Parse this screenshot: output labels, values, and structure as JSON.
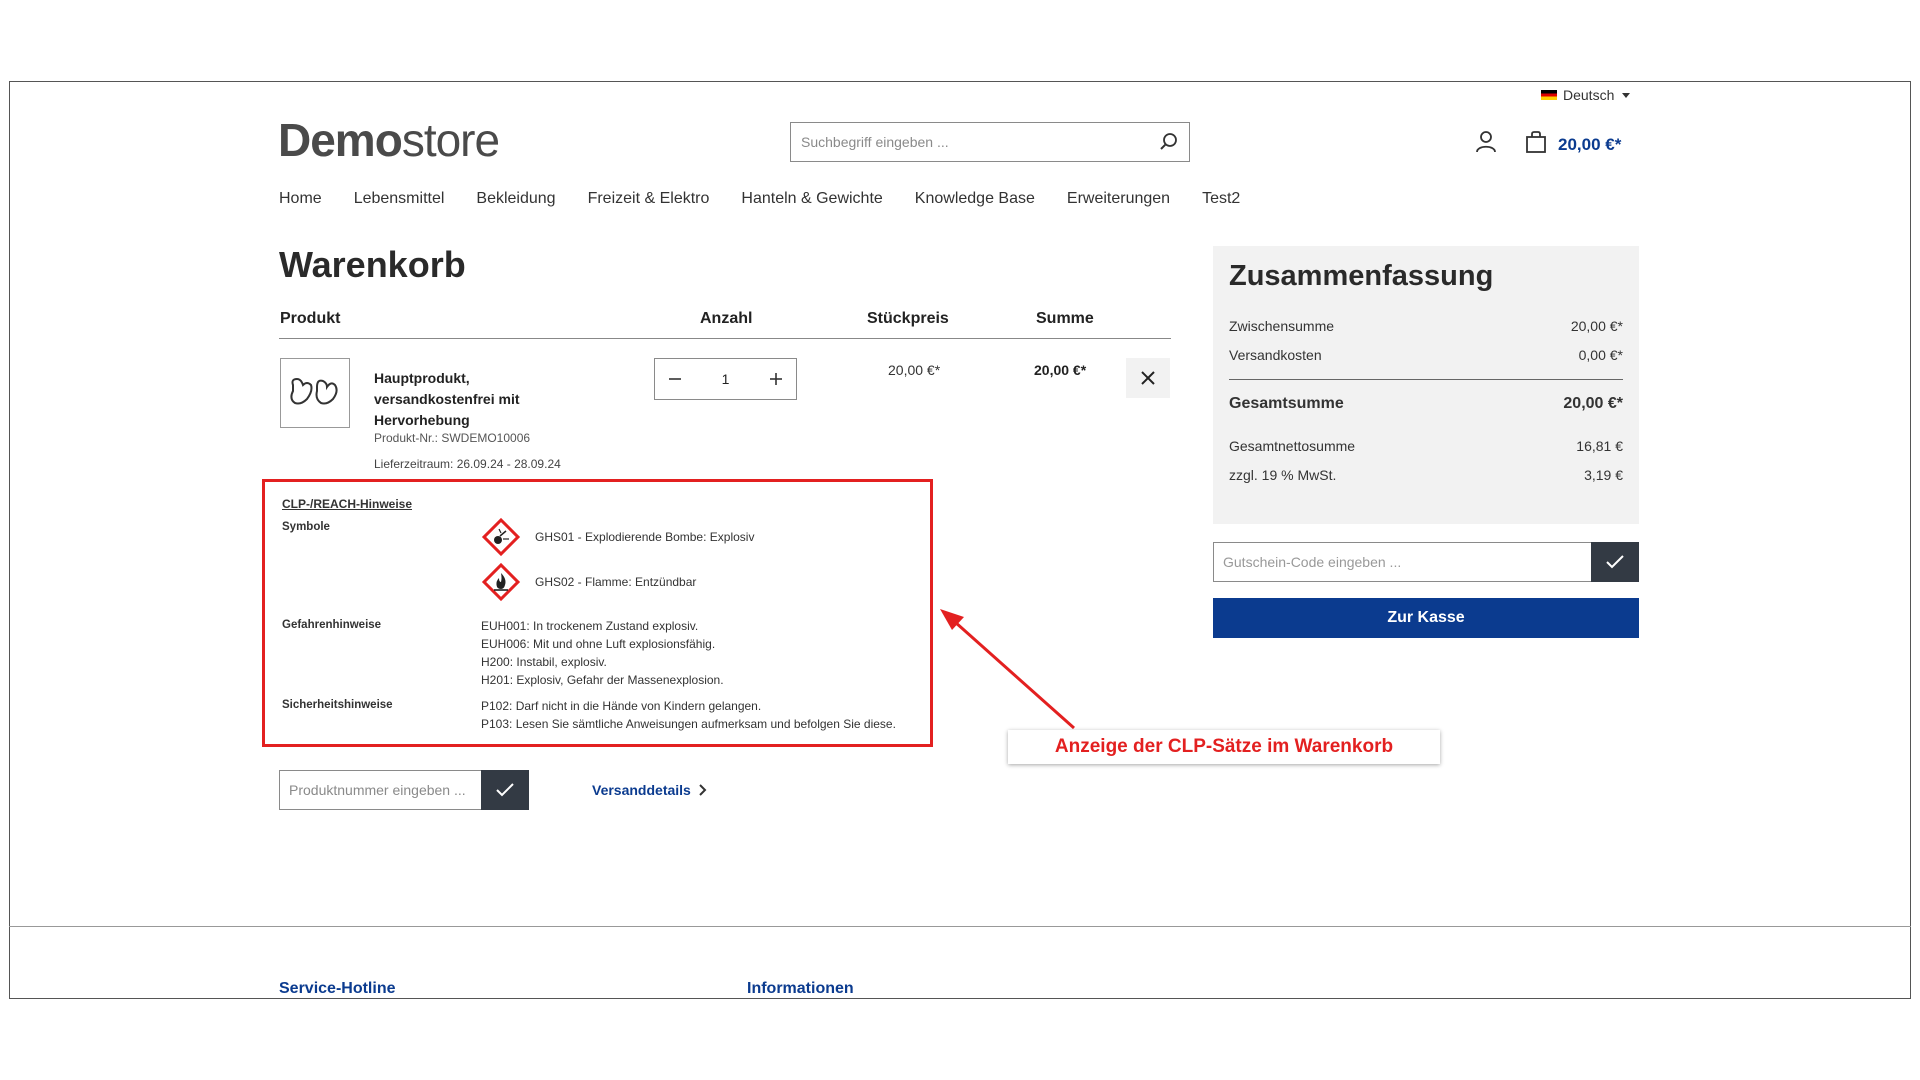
{
  "header": {
    "language": "Deutsch",
    "logo_bold": "Demo",
    "logo_light": "store",
    "search_placeholder": "Suchbegriff eingeben ...",
    "cart_total": "20,00 €*"
  },
  "nav": [
    "Home",
    "Lebensmittel",
    "Bekleidung",
    "Freizeit & Elektro",
    "Hanteln & Gewichte",
    "Knowledge Base",
    "Erweiterungen",
    "Test2"
  ],
  "cart": {
    "title": "Warenkorb",
    "columns": {
      "product": "Produkt",
      "quantity": "Anzahl",
      "unit_price": "Stückpreis",
      "total": "Summe"
    },
    "item": {
      "name": "Hauptprodukt, versandkostenfrei mit Hervorhebung",
      "number": "Produkt-Nr.: SWDEMO10006",
      "delivery": "Lieferzeitraum: 26.09.24 - 28.09.24",
      "quantity": "1",
      "unit_price": "20,00 €*",
      "total": "20,00 €*"
    },
    "clp": {
      "title": "CLP-/REACH-Hinweise",
      "symbols_label": "Symbole",
      "symbols": [
        {
          "icon": "ghs01-exploding-bomb-icon",
          "text": "GHS01 - Explodierende Bombe: Explosiv"
        },
        {
          "icon": "ghs02-flame-icon",
          "text": "GHS02 - Flamme: Entzündbar"
        }
      ],
      "hazard_label": "Gefahrenhinweise",
      "hazards": [
        "EUH001: In trockenem Zustand explosiv.",
        "EUH006: Mit und ohne Luft explosionsfähig.",
        "H200: Instabil, explosiv.",
        "H201: Explosiv, Gefahr der Massenexplosion."
      ],
      "safety_label": "Sicherheitshinweise",
      "safety": [
        "P102: Darf nicht in die Hände von Kindern gelangen.",
        "P103: Lesen Sie sämtliche Anweisungen aufmerksam und befolgen Sie diese."
      ]
    },
    "product_number_placeholder": "Produktnummer eingeben ...",
    "shipping_details": "Versanddetails"
  },
  "annotation": "Anzeige der CLP-Sätze im Warenkorb",
  "summary": {
    "title": "Zusammenfassung",
    "subtotal_label": "Zwischensumme",
    "subtotal": "20,00 €*",
    "shipping_label": "Versandkosten",
    "shipping": "0,00 €*",
    "grand_total_label": "Gesamtsumme",
    "grand_total": "20,00 €*",
    "net_label": "Gesamtnettosumme",
    "net": "16,81 €",
    "vat_label": "zzgl. 19 % MwSt.",
    "vat": "3,19 €",
    "coupon_placeholder": "Gutschein-Code eingeben ...",
    "checkout": "Zur Kasse"
  },
  "footer": {
    "hotline": "Service-Hotline",
    "info": "Informationen"
  },
  "colors": {
    "brand_blue": "#0b3b8f",
    "highlight_red": "#e32020",
    "dark_button": "#333a44"
  }
}
